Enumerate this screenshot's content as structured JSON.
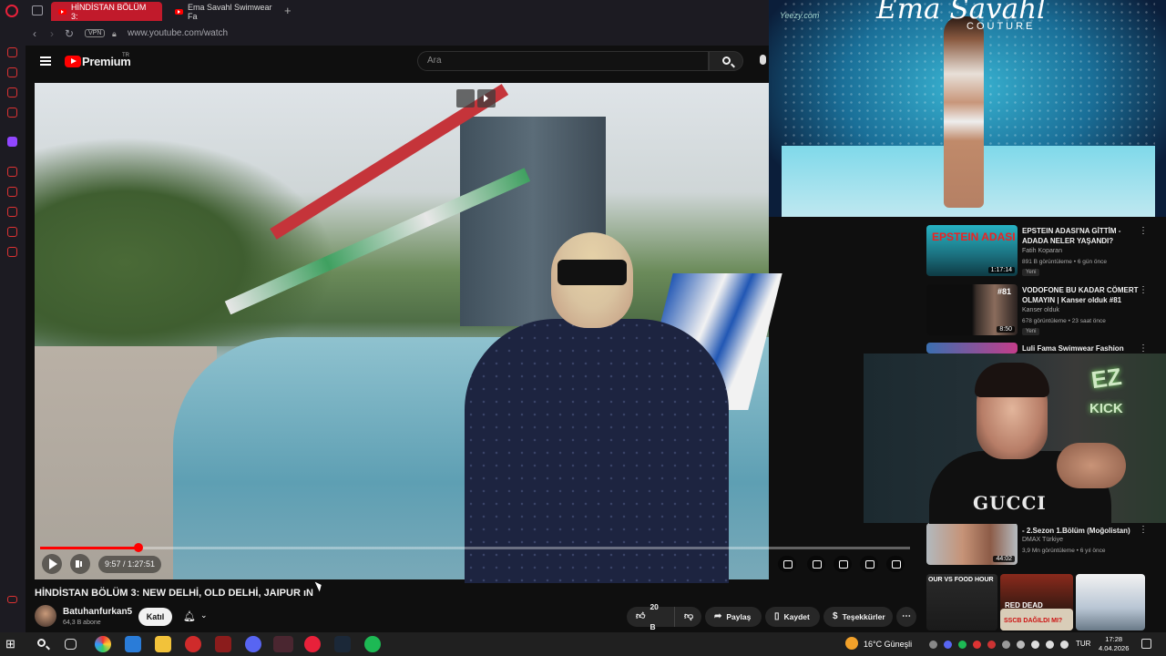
{
  "browser": {
    "tabs": [
      {
        "label": "HİNDİSTAN BÖLÜM 3:",
        "active": true
      },
      {
        "label": "Ema Savahl Swimwear Fa",
        "active": false
      }
    ],
    "vpn_label": "VPN",
    "url": "www.youtube.com/watch"
  },
  "youtube": {
    "logo_text": "Premium",
    "region": "TR",
    "search_placeholder": "Ara"
  },
  "player": {
    "current_time": "9:57",
    "duration": "1:27:51",
    "time_display": "9:57 / 1:27:51",
    "progress_fraction": 0.1133
  },
  "video": {
    "title": "HİNDİSTAN BÖLÜM 3: NEW DELHİ, OLD DELHİ, JAIPUR ıN",
    "channel": "Batuhanfurkan5",
    "subscribers": "64,3 B abone",
    "join_label": "Katıl",
    "likes": "20 B",
    "share_label": "Paylaş",
    "save_label": "Kaydet",
    "thanks_label": "Teşekkürler"
  },
  "overlay_runway": {
    "brand": "Ema Savahl",
    "sub": "COUTURE",
    "watermark": "Yeezy.com"
  },
  "recommendations": [
    {
      "title": "EPSTEIN ADASI'NA GİTTİM - ADADA NELER YAŞANDI?",
      "channel": "Fatih Koparan",
      "meta": "891 B görüntüleme • 6 gün önce",
      "badge": "Yeni",
      "duration": "1:17:14",
      "thumb_text": "EPSTEIN ADASI"
    },
    {
      "title": "VODOFONE BU KADAR CÖMERT OLMAYIN | Kanser olduk #81",
      "channel": "Kanser olduk",
      "meta": "678 görüntüleme • 23 saat önce",
      "badge": "Yeni",
      "duration": "8:50",
      "thumb_text": "#81"
    },
    {
      "title": "Luli Fama Swimwear Fashion"
    },
    {
      "title": "- 2.Sezon 1.Bölüm (Moğolistan)",
      "channel": "DMAX Türkiye",
      "meta": "3,9 Mn görüntüleme • 6 yıl önce",
      "duration": "44:02"
    }
  ],
  "shorts": [
    {
      "thumb_text": "OUR VS FOOD HOUR"
    },
    {
      "thumb_text": "RED DEAD REDEMPTION II"
    },
    {
      "thumb_text": "SSCB DAĞILDI MI?"
    },
    {
      "thumb_text": ""
    }
  ],
  "webcam": {
    "shirt_text": "GUCCI",
    "sign_text_1": "EZ",
    "sign_text_2": "KICK"
  },
  "taskbar": {
    "weather": "16°C  Güneşli",
    "language": "TUR",
    "time": "17:28",
    "date": "4.04.2026"
  },
  "colors": {
    "yt_red": "#ff0000",
    "opera_tab": "#c11a2b",
    "background": "#0f0f0f"
  }
}
